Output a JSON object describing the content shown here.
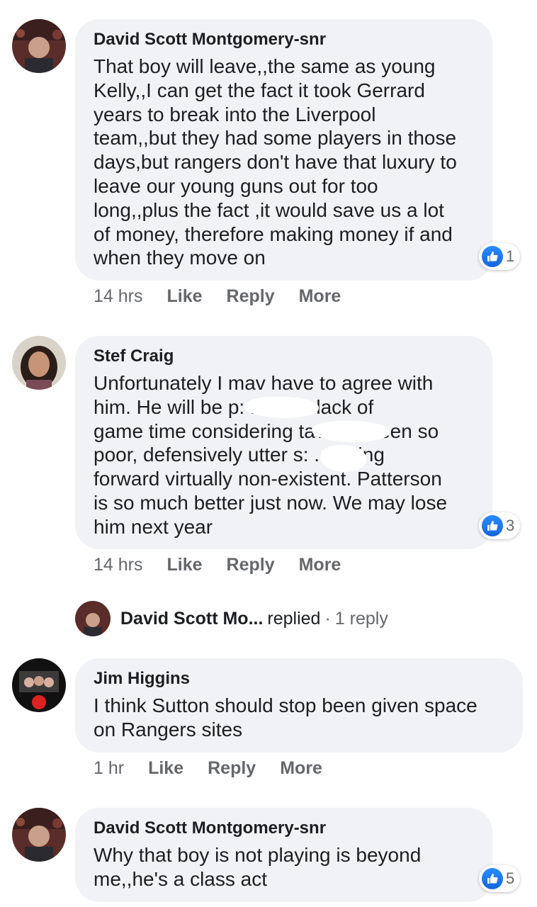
{
  "comments": [
    {
      "author": "David Scott Montgomery-snr",
      "text": "That boy will leave,,the same as young\nKelly,,I can get the fact it took Gerrard\nyears to break into the Liverpool\nteam,,but they had some players in those\ndays,but rangers don't have that luxury to\nleave our young guns out for too\nlong,,plus the fact ,it would save us a lot\nof money, therefore making money if and\nwhen they move on",
      "reaction_count": "1",
      "time": "14 hrs",
      "like": "Like",
      "reply": "Reply",
      "more": "More"
    },
    {
      "author": "Stef Craig",
      "text": "Unfortunately I mav have to agree with\nhim. He will be p:          f at the lack of\ngame time considering tav has been so\npoor, defensively utter s:         .d going\nforward virtually non-existent. Patterson\nis so much better just now. We may lose\nhim next year",
      "reaction_count": "3",
      "time": "14 hrs",
      "like": "Like",
      "reply": "Reply",
      "more": "More"
    },
    {
      "author": "Jim Higgins",
      "text": "I think Sutton should stop been given space\non Rangers sites",
      "time": "1 hr",
      "like": "Like",
      "reply": "Reply",
      "more": "More"
    },
    {
      "author": "David Scott Montgomery-snr",
      "text": "Why that boy is not playing is beyond\nme,,he's a class act",
      "reaction_count": "5"
    }
  ],
  "reply_summary": {
    "name": "David Scott Mo...",
    "action": "replied",
    "separator": "·",
    "count": "1 reply"
  },
  "icons": {
    "reaction": "thumbs-up-icon",
    "avatar": "avatar"
  },
  "colors": {
    "bubble": "#f0f2f5",
    "meta_text": "#65676b",
    "like_blue": "#1877f2"
  }
}
